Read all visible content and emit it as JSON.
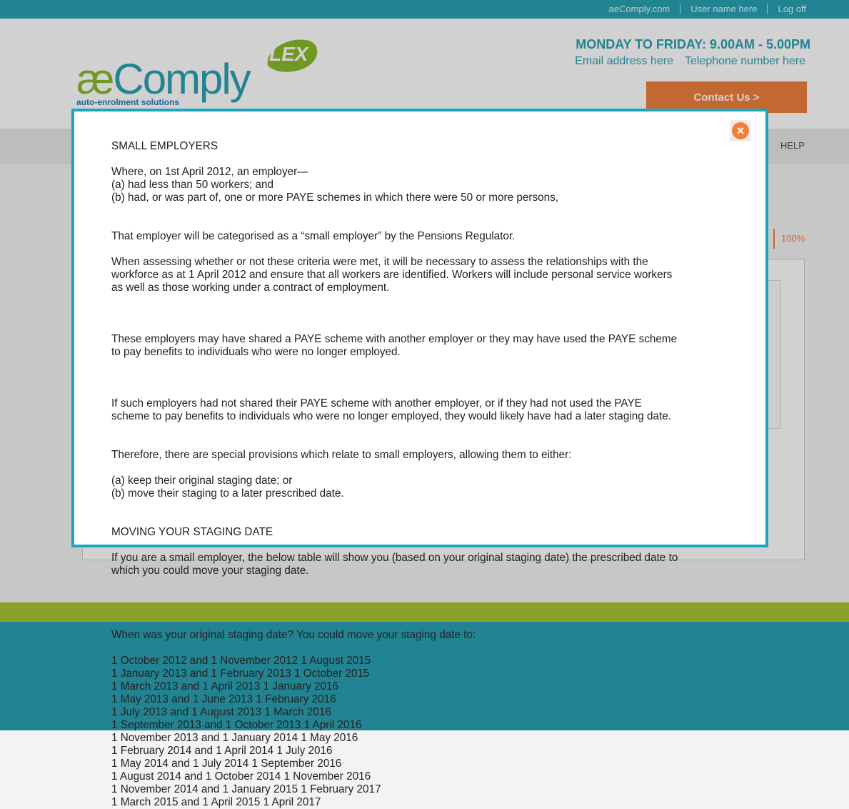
{
  "topbar": {
    "links": [
      "aeComply.com",
      "User name here",
      "Log off"
    ]
  },
  "header": {
    "logo": {
      "ae": "æ",
      "text": "Comply",
      "badge": "LEX",
      "tagline": "auto-enrolment solutions"
    },
    "hours": "MONDAY TO FRIDAY: 9.00AM - 5.00PM",
    "email": "Email address here",
    "telephone": "Telephone number here",
    "contact_button": "Contact Us >"
  },
  "nav": {
    "help": "HELP"
  },
  "progress": {
    "label": "100%",
    "value": 1.0
  },
  "modal": {
    "title_small": "SMALL EMPLOYERS",
    "p1": [
      "Where, on 1st April 2012, an employer—",
      "(a) had less than 50 workers; and",
      "(b) had, or was part of, one or more PAYE schemes in which there were 50 or more persons,"
    ],
    "p2": "That employer will be categorised as a “small employer” by the Pensions Regulator.",
    "p3": [
      "When assessing whether or not these criteria were met, it will be necessary to assess the relationships with the",
      "workforce as at 1 April 2012 and ensure that all workers are identified. Workers will include personal service workers",
      "as well as those working under a contract of employment."
    ],
    "p4": [
      "These employers may have shared a PAYE scheme with another employer or they may have used the PAYE scheme",
      "to pay benefits to individuals who were no longer employed."
    ],
    "p5": [
      "If such employers had not shared their PAYE scheme with another employer, or if they had not used the PAYE",
      "scheme to pay benefits to individuals who were no longer employed, they would likely have had a later staging date."
    ],
    "p6": "Therefore, there are special provisions which relate to small employers, allowing them to either:",
    "p7": [
      "(a) keep their original staging date; or",
      "(b) move their staging to a later prescribed date."
    ],
    "title_moving": "MOVING YOUR STAGING DATE",
    "p8": [
      "If you are a small employer, the below table will show you (based on your original staging date) the prescribed date to",
      "which you could move your staging date."
    ],
    "table_header": "When was your original staging date? You could move your staging date to:",
    "table_rows": [
      "1 October 2012 and 1 November 2012 1 August 2015",
      "1 January 2013 and 1 February 2013 1 October 2015",
      "1 March 2013 and 1 April 2013 1 January 2016",
      "1 May 2013 and 1 June 2013 1 February 2016",
      "1 July 2013 and 1 August 2013 1 March 2016",
      "1 September 2013 and 1 October 2013 1 April 2016",
      "1 November 2013 and 1 January 2014 1 May 2016",
      "1 February 2014 and 1 April 2014 1 July 2016",
      "1 May 2014 and 1 July 2014 1 September 2016",
      "1 August 2014 and 1 October 2014 1 November 2016",
      "1 November 2014 and 1 January 2015 1 February 2017",
      "1 March 2015 and 1 April 2015 1 April 2017"
    ]
  },
  "colors": {
    "accent": "#2aa1b3",
    "orange": "#f07f3c",
    "green": "#a6c534",
    "modal_border": "#1aa6bf"
  },
  "icons": {
    "close": "close-icon"
  }
}
